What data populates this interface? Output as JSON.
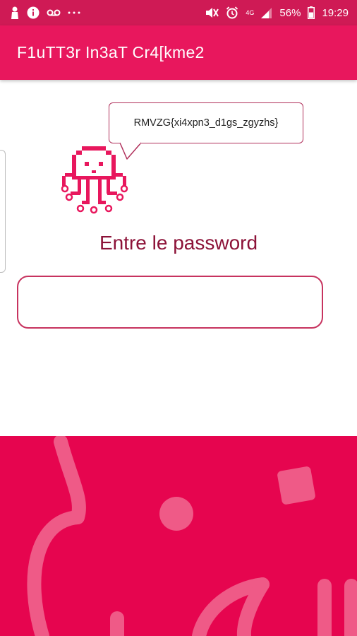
{
  "status_bar": {
    "battery_percent": "56%",
    "time": "19:29",
    "network_type": "4G",
    "left_icons": [
      "person-icon",
      "info-icon",
      "voicemail-icon",
      "more-dots-icon"
    ],
    "right_icons": [
      "mute-icon",
      "alarm-icon",
      "signal-icon",
      "battery-icon"
    ]
  },
  "app_bar": {
    "title": "F1uTT3r In3aT Cr4[kme2",
    "color": "#e8175d"
  },
  "speech_bubble": {
    "text": "RMVZG{xi4xpn3_d1gs_zgyzhs}"
  },
  "mascot": {
    "icon": "pixel-octopus-icon"
  },
  "password_prompt": {
    "label": "Entre le password",
    "value": ""
  },
  "colors": {
    "status_bar": "#cf1a55",
    "accent": "#e8175d",
    "footer": "#e6054f",
    "prompt_text": "#8c1238"
  }
}
